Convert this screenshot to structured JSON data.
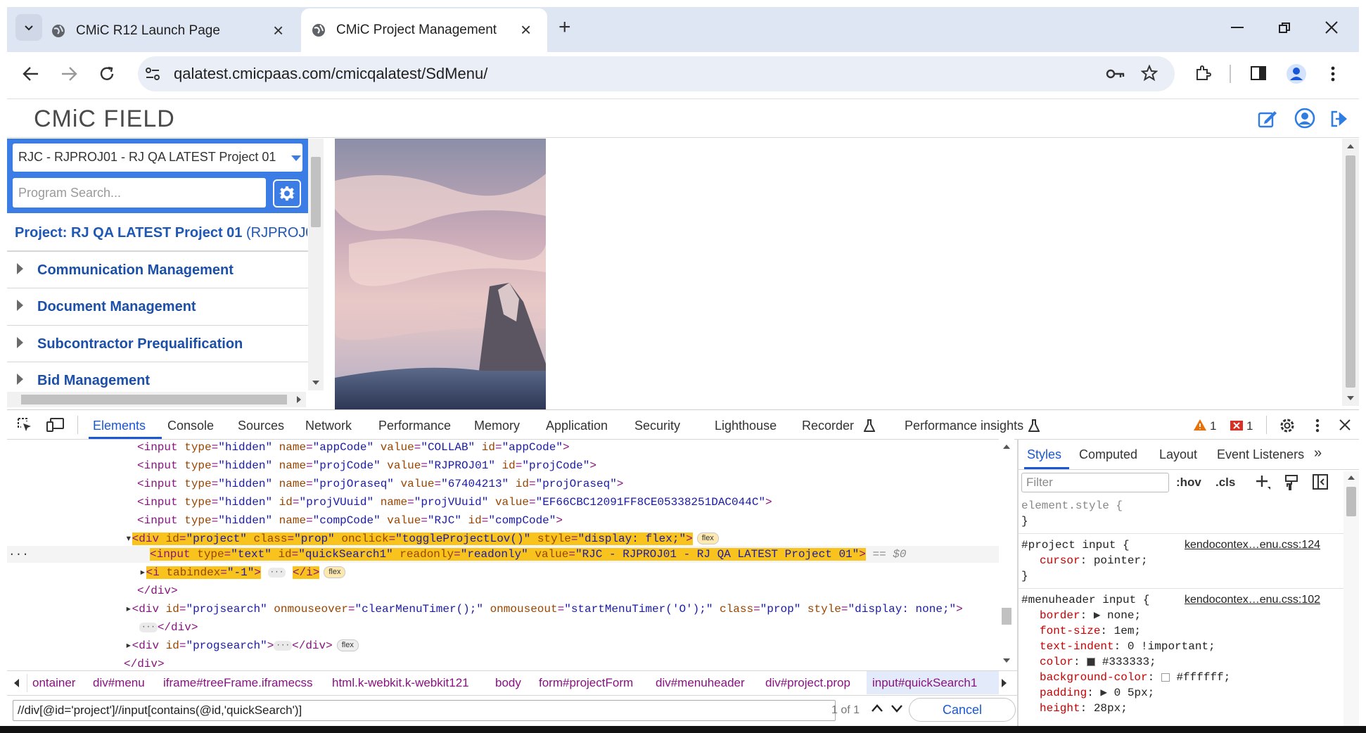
{
  "browser": {
    "tabs": [
      {
        "title": "CMiC R12 Launch Page",
        "active": false
      },
      {
        "title": "CMiC Project Management",
        "active": true
      }
    ],
    "url": "qalatest.cmicpaas.com/cmicqalatest/SdMenu/"
  },
  "app": {
    "logo": "CMiC FIELD",
    "project_selector": "RJC - RJPROJ01 - RJ QA LATEST Project 01",
    "program_search_placeholder": "Program Search...",
    "project_title_prefix": "Project: RJ QA LATEST Project 01",
    "project_title_code": " (RJPROJ0",
    "menu_items": [
      "Communication Management",
      "Document Management",
      "Subcontractor Prequalification",
      "Bid Management"
    ]
  },
  "devtools": {
    "tabs": [
      "Elements",
      "Console",
      "Sources",
      "Network",
      "Performance",
      "Memory",
      "Application",
      "Security",
      "Lighthouse",
      "Recorder",
      "Performance insights"
    ],
    "warning_count": "1",
    "error_count": "1",
    "dom_lines": [
      {
        "tag": "input",
        "attrs": [
          [
            "type",
            "hidden"
          ],
          [
            "name",
            "appCode"
          ],
          [
            "value",
            "COLLAB"
          ],
          [
            "id",
            "appCode"
          ]
        ]
      },
      {
        "tag": "input",
        "attrs": [
          [
            "type",
            "hidden"
          ],
          [
            "name",
            "projCode"
          ],
          [
            "value",
            "RJPROJ01"
          ],
          [
            "id",
            "projCode"
          ]
        ]
      },
      {
        "tag": "input",
        "attrs": [
          [
            "type",
            "hidden"
          ],
          [
            "name",
            "projOraseq"
          ],
          [
            "value",
            "67404213"
          ],
          [
            "id",
            "projOraseq"
          ]
        ]
      },
      {
        "tag": "input",
        "attrs": [
          [
            "type",
            "hidden"
          ],
          [
            "id",
            "projVUuid"
          ],
          [
            "name",
            "projVUuid"
          ],
          [
            "value",
            "EF66CBC12091FF8CE05338251DAC044C"
          ]
        ]
      },
      {
        "tag": "input",
        "attrs": [
          [
            "type",
            "hidden"
          ],
          [
            "name",
            "compCode"
          ],
          [
            "value",
            "RJC"
          ],
          [
            "id",
            "compCode"
          ]
        ]
      },
      {
        "tag": "div",
        "attrs": [
          [
            "id",
            "project"
          ],
          [
            "class",
            "prop"
          ],
          [
            "onclick",
            "toggleProjectLov()"
          ],
          [
            "style",
            "display: flex;"
          ]
        ],
        "badge": "flex"
      },
      {
        "tag": "input",
        "attrs": [
          [
            "type",
            "text"
          ],
          [
            "id",
            "quickSearch1"
          ],
          [
            "readonly",
            "readonly"
          ],
          [
            "value",
            "RJC - RJPROJ01 - RJ QA LATEST Project 01"
          ]
        ],
        "suffix": "== $0"
      },
      {
        "tag": "i",
        "attrs": [
          [
            "tabindex",
            "-1"
          ]
        ],
        "badge": "flex"
      },
      {
        "close": "div"
      },
      {
        "tag": "div",
        "attrs": [
          [
            "id",
            "projsearch"
          ],
          [
            "onmouseover",
            "clearMenuTimer();"
          ],
          [
            "onmouseout",
            "startMenuTimer('O');"
          ],
          [
            "class",
            "prop"
          ],
          [
            "style",
            "display: none;"
          ]
        ]
      },
      {
        "close": "div"
      },
      {
        "tag": "div",
        "attrs": [
          [
            "id",
            "progsearch"
          ]
        ],
        "badge": "flex"
      },
      {
        "close": "div"
      }
    ],
    "breadcrumbs": [
      "ontainer",
      "div#menu",
      "iframe#treeFrame.iframecss",
      "html.k-webkit.k-webkit121",
      "body",
      "form#projectForm",
      "div#menuheader",
      "div#project.prop",
      "input#quickSearch1"
    ],
    "search_query": "//div[@id='project']//input[contains(@id,'quickSearch')]",
    "match_text": "1 of 1",
    "cancel_label": "Cancel",
    "styles_tabs": [
      "Styles",
      "Computed",
      "Layout",
      "Event Listeners"
    ],
    "filter_placeholder": "Filter",
    "hov": ":hov",
    "cls": ".cls",
    "rules": [
      {
        "selector": "element.style {",
        "source": "",
        "props": []
      },
      {
        "selector": "#project input {",
        "source": "kendocontex…enu.css:124",
        "props": [
          [
            "cursor",
            "pointer;"
          ]
        ]
      },
      {
        "selector": "#menuheader input {",
        "source": "kendocontex…enu.css:102",
        "props": [
          [
            "border",
            "none;"
          ],
          [
            "font-size",
            "1em;"
          ],
          [
            "text-indent",
            "0 !important;"
          ],
          [
            "color",
            "#333333;"
          ],
          [
            "background-color",
            "#ffffff;"
          ],
          [
            "padding",
            "0 5px;"
          ],
          [
            "height",
            "28px;"
          ]
        ]
      }
    ]
  }
}
